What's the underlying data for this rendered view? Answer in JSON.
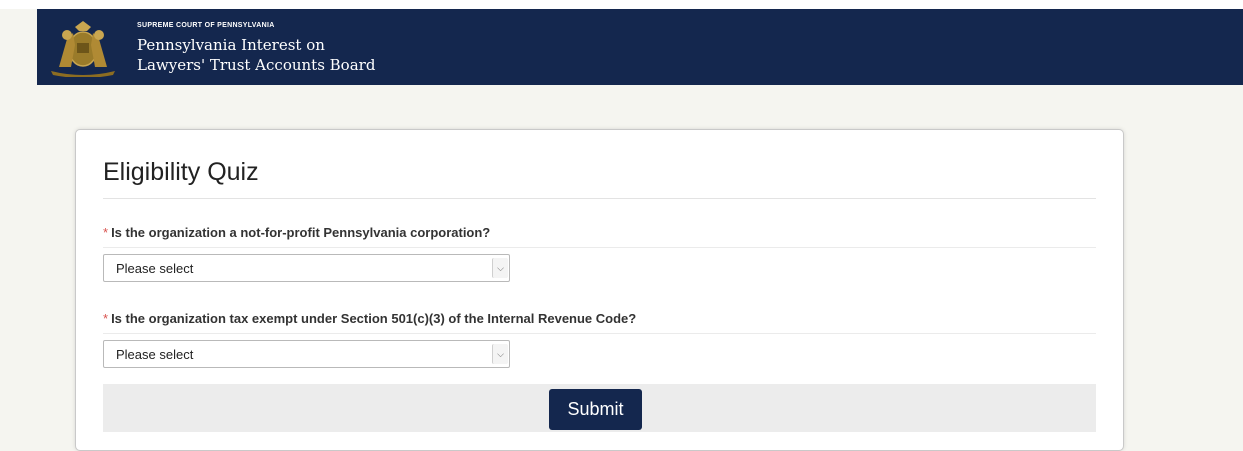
{
  "header": {
    "kicker": "SUPREME COURT OF PENNSYLVANIA",
    "title_line1": "Pennsylvania Interest on",
    "title_line2": "Lawyers' Trust Accounts Board"
  },
  "quiz": {
    "title": "Eligibility Quiz",
    "questions": [
      {
        "required_marker": "*",
        "text": "Is the organization a not-for-profit Pennsylvania corporation?",
        "selected": "Please select"
      },
      {
        "required_marker": "*",
        "text": "Is the organization tax exempt under Section 501(c)(3) of the Internal Revenue Code?",
        "selected": "Please select"
      }
    ],
    "submit_label": "Submit"
  },
  "colors": {
    "brand_navy": "#14274e",
    "required_red": "#d9534f"
  }
}
